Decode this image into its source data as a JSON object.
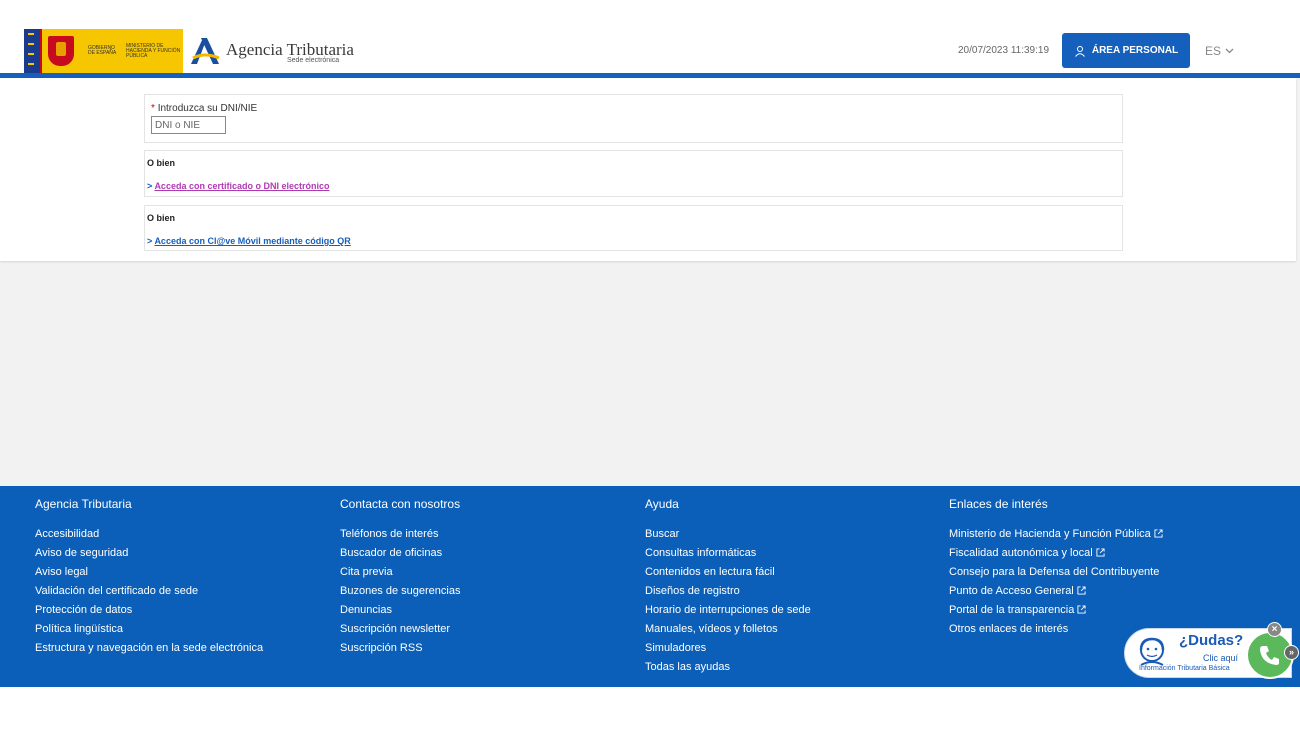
{
  "header": {
    "gov_text_1": "Gobierno de España",
    "gov_text_2": "Ministerio de Hacienda y Función Pública",
    "brand_title": "Agencia Tributaria",
    "brand_subtitle": "Sede electrónica",
    "datetime": "20/07/2023 11:39:19",
    "area_personal_label": "ÁREA PERSONAL",
    "language": "ES",
    "accent_color": "#1560bd"
  },
  "form": {
    "dni_label": "Introduzca su DNI/NIE",
    "required_marker": "*",
    "dni_placeholder": "DNI o NIE",
    "dni_value": ""
  },
  "alternatives": [
    {
      "heading": "O bien",
      "prefix": ">",
      "link": "Acceda con certificado o DNI electrónico"
    },
    {
      "heading": "O bien",
      "prefix": ">",
      "link": "Acceda con Cl@ve Móvil mediante código QR"
    }
  ],
  "footer": {
    "columns": [
      {
        "title": "Agencia Tributaria",
        "links": [
          "Accesibilidad",
          "Aviso de seguridad",
          "Aviso legal",
          "Validación del certificado de sede",
          "Protección de datos",
          "Política lingüística",
          "Estructura y navegación en la sede electrónica"
        ]
      },
      {
        "title": "Contacta con nosotros",
        "links": [
          "Teléfonos de interés",
          "Buscador de oficinas",
          "Cita previa",
          "Buzones de sugerencias",
          "Denuncias",
          "Suscripción newsletter",
          "Suscripción RSS"
        ]
      },
      {
        "title": "Ayuda",
        "links": [
          "Buscar",
          "Consultas informáticas",
          "Contenidos en lectura fácil",
          "Diseños de registro",
          "Horario de interrupciones de sede",
          "Manuales, vídeos y folletos",
          "Simuladores",
          "Todas las ayudas"
        ]
      },
      {
        "title": "Enlaces de interés",
        "links": [
          "Ministerio de Hacienda y Función Pública",
          "Fiscalidad autonómica y local",
          "Consejo para la Defensa del Contribuyente",
          "Punto de Acceso General",
          "Portal de la transparencia",
          "Otros enlaces de interés"
        ],
        "external": [
          true,
          true,
          false,
          true,
          true,
          false
        ]
      }
    ]
  },
  "help_widget": {
    "title": "¿Dudas?",
    "cta": "Clic aquí",
    "subtitle": "Información Tributaria Básica"
  }
}
